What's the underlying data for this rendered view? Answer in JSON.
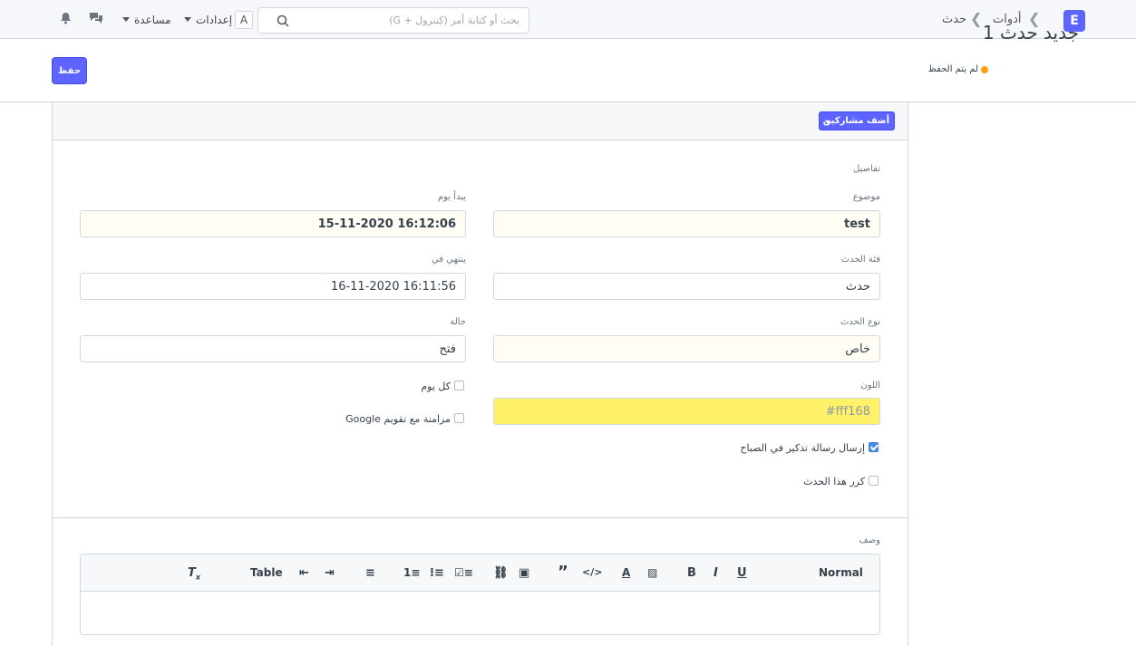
{
  "navbar": {
    "logo": "E",
    "breadcrumb": [
      "أدوات",
      "حدث"
    ],
    "search_placeholder": "بحث أو كتابة أمر (كنترول + G)",
    "avatar": "A",
    "settings": "إعدادات",
    "help": "مساعدة"
  },
  "page": {
    "title": "جديد حدث 1",
    "unsaved": "لم يتم الحفظ",
    "save": "حفظ"
  },
  "form": {
    "add_participants": "أضف مشاركين",
    "section_details": "تفاصيل",
    "subject_label": "موضوع",
    "subject_value": "test",
    "starts_on_label": "يبدأ يوم",
    "starts_on_value": "15-11-2020 16:12:06",
    "category_label": "فئة الحدث",
    "category_value": "حدث",
    "ends_on_label": "ينتهي في",
    "ends_on_value": "16-11-2020 16:11:56",
    "type_label": "نوع الحدث",
    "type_value": "خاص",
    "status_label": "حالة",
    "status_value": "فتح",
    "color_label": "اللون",
    "color_value": "#fff168",
    "all_day": "كل يوم",
    "sync_google": "مزامنة مع تقويم Google",
    "send_reminder": "إرسال رسالة تذكير في الصباح",
    "repeat_event": "كرر هذا الحدث",
    "description_label": "وصف"
  },
  "editor_toolbar": {
    "normal": "Normal",
    "table": "Table"
  },
  "colors": {
    "primary": "#5e64ff",
    "color_field": "#fff168",
    "unsaved_dot": "#ffa00a"
  }
}
